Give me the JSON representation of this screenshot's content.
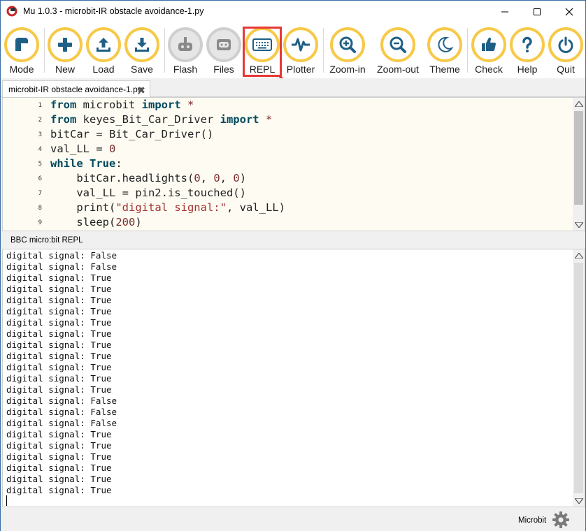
{
  "window": {
    "title": "Mu 1.0.3 - microbit-IR obstacle avoidance-1.py"
  },
  "toolbar": {
    "buttons": [
      {
        "label": "Mode",
        "icon": "mode-icon"
      },
      {
        "label": "New",
        "icon": "plus-icon"
      },
      {
        "label": "Load",
        "icon": "upload-icon"
      },
      {
        "label": "Save",
        "icon": "download-icon"
      },
      {
        "label": "Flash",
        "icon": "flash-icon"
      },
      {
        "label": "Files",
        "icon": "files-icon"
      },
      {
        "label": "REPL",
        "icon": "keyboard-icon"
      },
      {
        "label": "Plotter",
        "icon": "pulse-icon"
      },
      {
        "label": "Zoom-in",
        "icon": "zoom-in-icon"
      },
      {
        "label": "Zoom-out",
        "icon": "zoom-out-icon"
      },
      {
        "label": "Theme",
        "icon": "moon-icon"
      },
      {
        "label": "Check",
        "icon": "thumbs-up-icon"
      },
      {
        "label": "Help",
        "icon": "question-icon"
      },
      {
        "label": "Quit",
        "icon": "power-icon"
      }
    ],
    "accent_color": "#f7c948",
    "highlight_color": "#e53935"
  },
  "tab": {
    "label": "microbit-IR obstacle avoidance-1.py",
    "close": "✖"
  },
  "editor": {
    "line_numbers": [
      "1",
      "2",
      "3",
      "4",
      "5",
      "6",
      "7",
      "8",
      "9"
    ],
    "lines": [
      "from microbit import *",
      "from keyes_Bit_Car_Driver import *",
      "bitCar = Bit_Car_Driver()",
      "val_LL = 0",
      "while True:",
      "    bitCar.headlights(0, 0, 0)",
      "    val_LL = pin2.is_touched()",
      "    print(\"digital signal:\", val_LL)",
      "    sleep(200)"
    ]
  },
  "repl": {
    "title": "BBC micro:bit REPL",
    "lines": [
      "digital signal: False",
      "digital signal: False",
      "digital signal: True",
      "digital signal: True",
      "digital signal: True",
      "digital signal: True",
      "digital signal: True",
      "digital signal: True",
      "digital signal: True",
      "digital signal: True",
      "digital signal: True",
      "digital signal: True",
      "digital signal: True",
      "digital signal: False",
      "digital signal: False",
      "digital signal: False",
      "digital signal: True",
      "digital signal: True",
      "digital signal: True",
      "digital signal: True",
      "digital signal: True",
      "digital signal: True"
    ]
  },
  "status": {
    "mode": "Microbit"
  }
}
